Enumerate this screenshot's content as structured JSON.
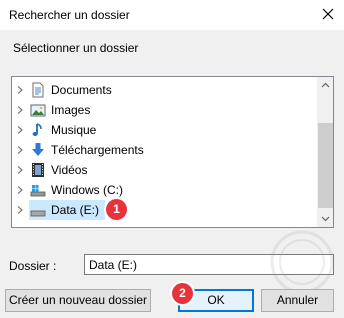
{
  "window": {
    "title": "Rechercher un dossier"
  },
  "prompt": "Sélectionner un dossier",
  "tree": {
    "items": [
      {
        "label": "Documents",
        "icon": "documents-icon"
      },
      {
        "label": "Images",
        "icon": "images-icon"
      },
      {
        "label": "Musique",
        "icon": "music-icon"
      },
      {
        "label": "Téléchargements",
        "icon": "downloads-icon"
      },
      {
        "label": "Vidéos",
        "icon": "videos-icon"
      },
      {
        "label": "Windows (C:)",
        "icon": "windows-drive-icon"
      },
      {
        "label": "Data (E:)",
        "icon": "drive-icon",
        "selected": true
      }
    ]
  },
  "folder": {
    "label": "Dossier :",
    "value": "Data (E:)"
  },
  "buttons": {
    "new_folder": "Créer un nouveau dossier",
    "ok": "OK",
    "cancel": "Annuler"
  },
  "badges": {
    "step1": "1",
    "step2": "2"
  },
  "colors": {
    "selection": "#cce8ff",
    "accent": "#0078d7",
    "badge": "#e8323c"
  }
}
